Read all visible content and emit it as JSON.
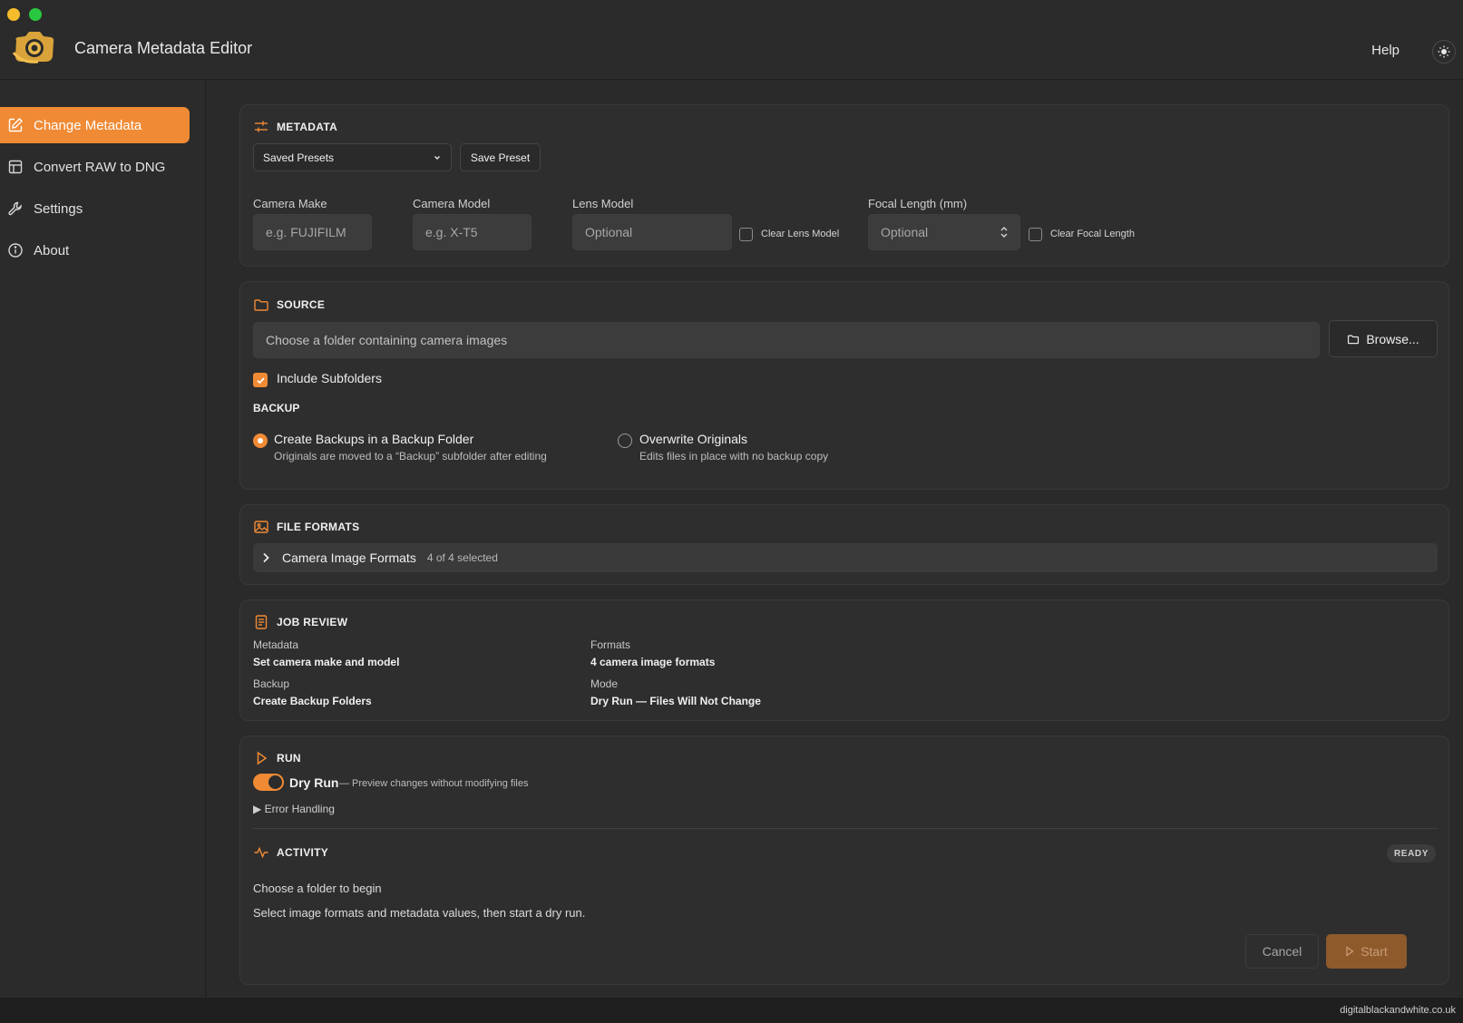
{
  "app": {
    "title": "Camera Metadata Editor",
    "help": "Help"
  },
  "sidebar": {
    "items": [
      {
        "label": "Change Metadata",
        "icon": "edit-icon",
        "active": true
      },
      {
        "label": "Convert RAW to DNG",
        "icon": "layout-icon",
        "active": false
      },
      {
        "label": "Settings",
        "icon": "wrench-icon",
        "active": false
      },
      {
        "label": "About",
        "icon": "info-icon",
        "active": false
      }
    ]
  },
  "metadata": {
    "title": "METADATA",
    "presets_select": "Saved Presets",
    "save_preset": "Save Preset",
    "camera_make_label": "Camera Make",
    "camera_make_placeholder": "e.g. FUJIFILM",
    "camera_model_label": "Camera Model",
    "camera_model_placeholder": "e.g. X-T5",
    "lens_model_label": "Lens Model",
    "lens_model_placeholder": "Optional",
    "clear_lens_model": "Clear Lens Model",
    "focal_length_label": "Focal Length (mm)",
    "focal_length_placeholder": "Optional",
    "clear_focal_length": "Clear Focal Length"
  },
  "source": {
    "title": "SOURCE",
    "folder_placeholder": "Choose a folder containing camera images",
    "browse": "Browse...",
    "include_subfolders": "Include Subfolders",
    "backup_title": "BACKUP",
    "option_backup_title": "Create Backups in a Backup Folder",
    "option_backup_desc": "Originals are moved to a “Backup” subfolder after editing",
    "option_overwrite_title": "Overwrite Originals",
    "option_overwrite_desc": "Edits files in place with no backup copy"
  },
  "file_formats": {
    "title": "FILE FORMATS",
    "row_label": "Camera Image Formats",
    "row_count": "4 of 4 selected"
  },
  "job_review": {
    "title": "JOB REVIEW",
    "metadata_label": "Metadata",
    "metadata_value": "Set camera make and model",
    "formats_label": "Formats",
    "formats_value": "4 camera image formats",
    "backup_label": "Backup",
    "backup_value": "Create Backup Folders",
    "mode_label": "Mode",
    "mode_value": "Dry Run — Files Will Not Change"
  },
  "run": {
    "title": "RUN",
    "dry_run": "Dry Run",
    "dry_run_desc": "— Preview changes without modifying files",
    "error_handling": "▶ Error Handling"
  },
  "activity": {
    "title": "ACTIVITY",
    "status": "READY",
    "line1": "Choose a folder to begin",
    "line2": "Select image formats and metadata values, then start a dry run.",
    "cancel": "Cancel",
    "start": "Start"
  },
  "footer": {
    "text": "digitalblackandwhite.co.uk"
  },
  "colors": {
    "accent": "#f08a34",
    "background": "#2a2a2a",
    "panel": "#2e2e2e"
  }
}
